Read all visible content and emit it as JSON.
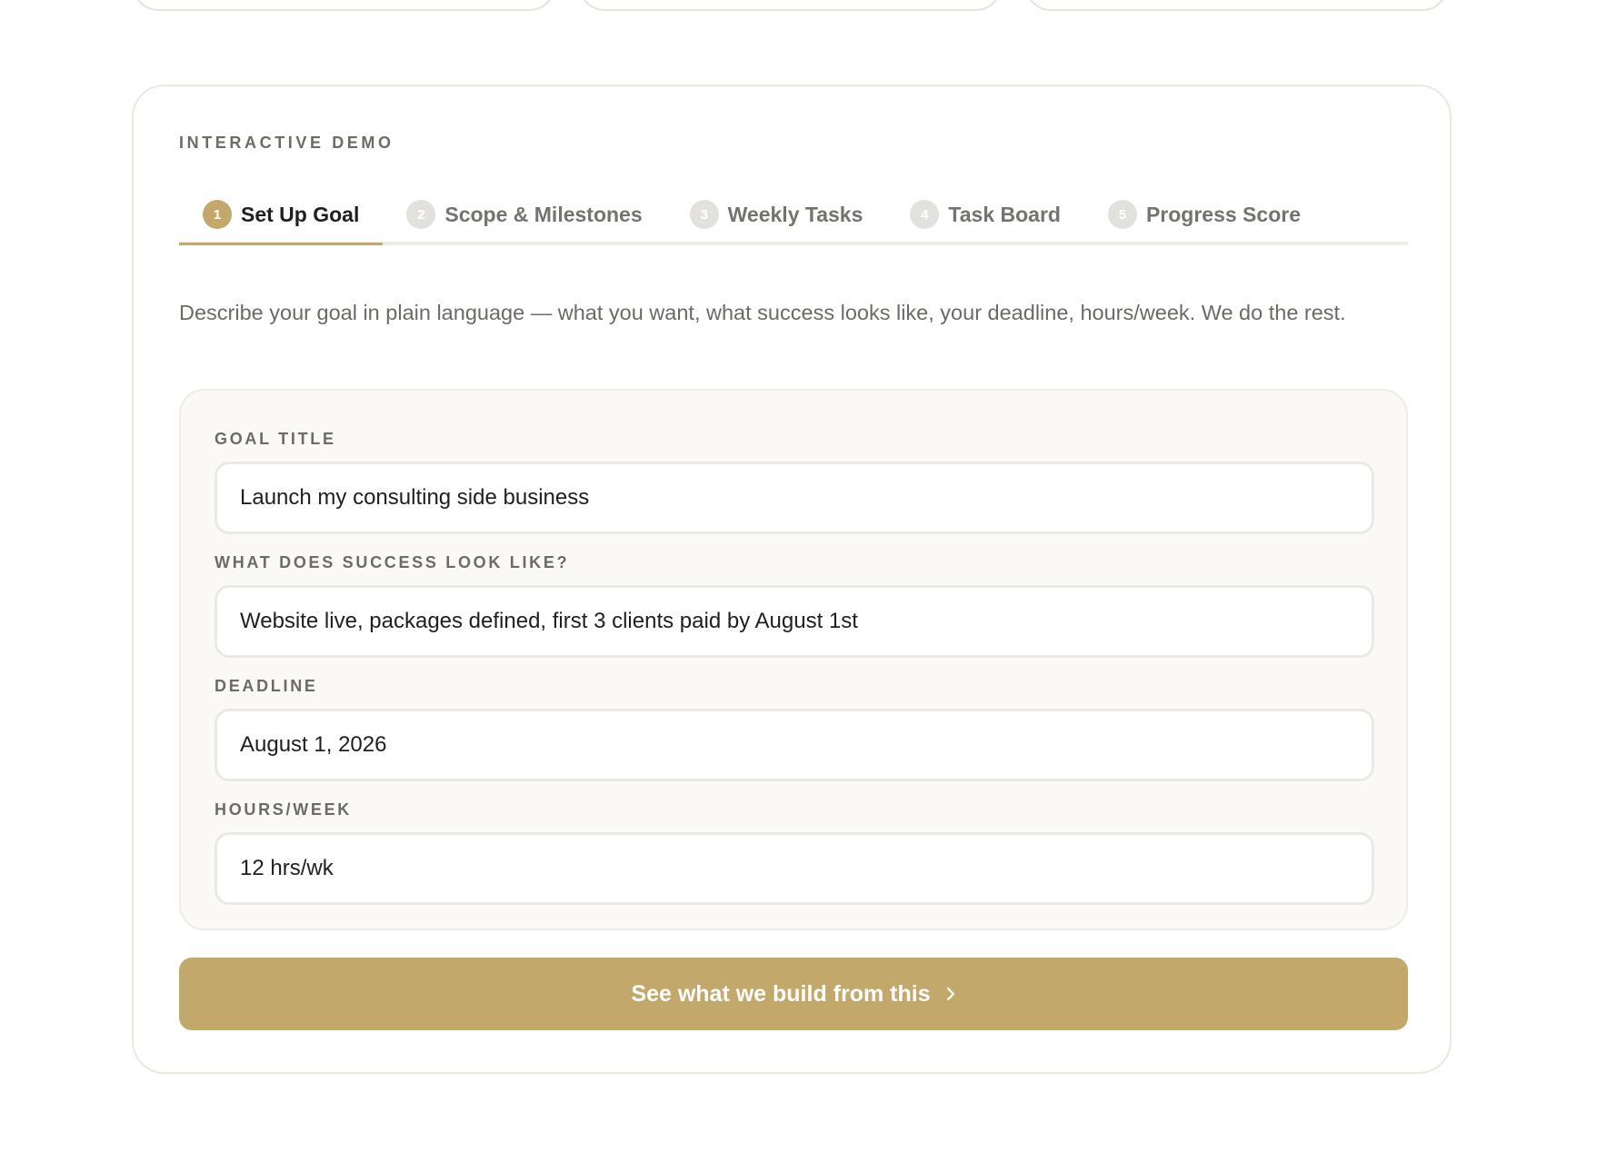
{
  "demo": {
    "eyebrow": "INTERACTIVE DEMO",
    "tabs": [
      {
        "num": "1",
        "label": "Set Up Goal",
        "active": true
      },
      {
        "num": "2",
        "label": "Scope & Milestones",
        "active": false
      },
      {
        "num": "3",
        "label": "Weekly Tasks",
        "active": false
      },
      {
        "num": "4",
        "label": "Task Board",
        "active": false
      },
      {
        "num": "5",
        "label": "Progress Score",
        "active": false
      }
    ],
    "description": "Describe your goal in plain language — what you want, what success looks like, your deadline, hours/week. We do the rest.",
    "form": {
      "goal_title": {
        "label": "GOAL TITLE",
        "value": "Launch my consulting side business"
      },
      "success": {
        "label": "WHAT DOES SUCCESS LOOK LIKE?",
        "value": "Website live, packages defined, first 3 clients paid by August 1st"
      },
      "deadline": {
        "label": "DEADLINE",
        "value": "August 1, 2026"
      },
      "hours": {
        "label": "HOURS/WEEK",
        "value": "12 hrs/wk"
      }
    },
    "cta": {
      "label": "See what we build from this",
      "icon": "chevron-right-icon"
    }
  },
  "colors": {
    "accent": "#c3a86b",
    "inactive_badge": "#e3e1dd",
    "muted_text": "#6e6b66"
  }
}
